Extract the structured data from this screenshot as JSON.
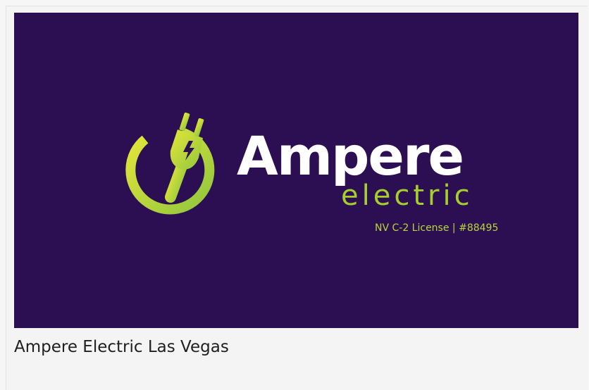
{
  "banner": {
    "brand_name": "Ampere",
    "brand_sub": "electric",
    "license": "NV C-2 License | #88495",
    "logo_icon": "electric-plug-icon",
    "colors": {
      "background": "#2c0e52",
      "accent_green": "#a6cf2e",
      "accent_yellow": "#e4e33a",
      "text_white": "#ffffff"
    }
  },
  "caption": "Ampere Electric Las Vegas"
}
